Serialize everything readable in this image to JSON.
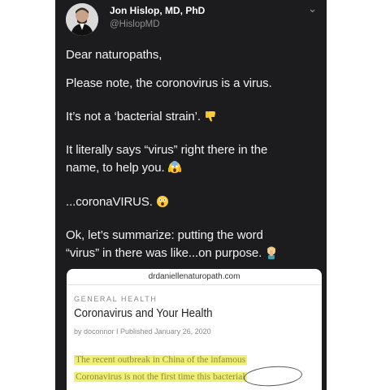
{
  "tweet": {
    "author_name": "Jon Hislop, MD, PhD",
    "author_handle": "@HislopMD",
    "lines": [
      "Dear naturopaths,",
      "Please note, the coronovirus is a virus.",
      "It’s not a ‘bacterial strain’.",
      "It literally says “virus” right there in the",
      "name, to help you.",
      "...coronaVIRUS.",
      "Ok, let’s summarize: putting the word",
      "“virus” in there was like...on purpose."
    ],
    "emojis": [
      "thumbs-down-emoji",
      "screaming-face-emoji",
      "astonished-face-emoji",
      "facepalm-emoji"
    ]
  },
  "link_preview": {
    "domain": "drdaniellenaturopath.com",
    "category": "GENERAL HEALTH",
    "title": "Coronavirus and Your Health",
    "meta": "by doconnor  I  Published January 26, 2020",
    "excerpt_lines": [
      "The recent outbreak in China of the infamous",
      "Coronavirus is not the first time this bacterial"
    ]
  },
  "colors": {
    "background": "#1c1c1e",
    "text": "#f2f2f2",
    "muted": "#8e8e93",
    "highlight": "#f0f078"
  }
}
